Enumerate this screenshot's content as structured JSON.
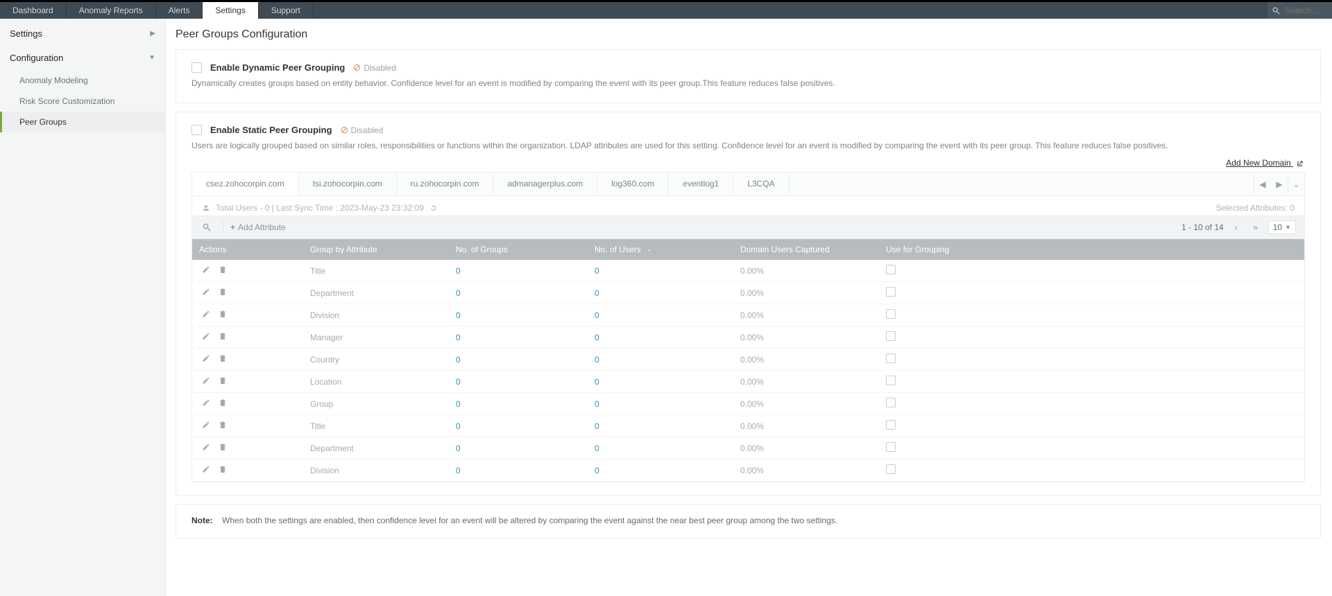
{
  "topnav": {
    "tabs": [
      "Dashboard",
      "Anomaly Reports",
      "Alerts",
      "Settings",
      "Support"
    ],
    "active_index": 3,
    "search_placeholder": "Search..."
  },
  "sidebar": {
    "sections": {
      "settings_label": "Settings",
      "configuration_label": "Configuration"
    },
    "config_items": [
      "Anomaly Modeling",
      "Risk Score Customization",
      "Peer Groups"
    ],
    "active_config_index": 2
  },
  "page": {
    "title": "Peer Groups Configuration"
  },
  "dynamic": {
    "title": "Enable Dynamic Peer Grouping",
    "status": "Disabled",
    "desc": "Dynamically creates groups based on entity behavior. Confidence level for an event is modified by comparing the event with its peer group.This feature reduces false positives."
  },
  "static": {
    "title": "Enable Static Peer Grouping",
    "status": "Disabled",
    "desc": "Users are logically grouped based on similar roles, responsibilities or functions within the organization. LDAP attributes are used for this setting. Confidence level for an event is modified by comparing the event with its peer group. This feature reduces false positives.",
    "add_new_domain": "Add New Domain"
  },
  "domains": {
    "tabs": [
      "csez.zohocorpin.com",
      "tsi.zohocorpin.com",
      "ru.zohocorpin.com",
      "admanagerplus.com",
      "log360.com",
      "eventlog1",
      "L3CQA"
    ],
    "active_index": 0
  },
  "summary": {
    "total_users_label": "Total Users - ",
    "total_users": "0",
    "sep": " | ",
    "last_sync_label": "Last Sync Time : ",
    "last_sync_time": "2023-May-23 23:32:09",
    "selected_attr_label": "Selected Attributes: ",
    "selected_attr_value": "0"
  },
  "toolbar": {
    "add_attribute": "Add Attribute",
    "pager_text": "1 - 10 of 14",
    "page_size": "10"
  },
  "table": {
    "headers": {
      "actions": "Actions",
      "group_by": "Group by Attribute",
      "no_groups": "No. of Groups",
      "no_users": "No. of Users",
      "captured": "Domain Users Captured",
      "use_for": "Use for Grouping"
    },
    "rows": [
      {
        "attr": "Title",
        "groups": "0",
        "users": "0",
        "captured": "0.00%"
      },
      {
        "attr": "Department",
        "groups": "0",
        "users": "0",
        "captured": "0.00%"
      },
      {
        "attr": "Division",
        "groups": "0",
        "users": "0",
        "captured": "0.00%"
      },
      {
        "attr": "Manager",
        "groups": "0",
        "users": "0",
        "captured": "0.00%"
      },
      {
        "attr": "Country",
        "groups": "0",
        "users": "0",
        "captured": "0.00%"
      },
      {
        "attr": "Location",
        "groups": "0",
        "users": "0",
        "captured": "0.00%"
      },
      {
        "attr": "Group",
        "groups": "0",
        "users": "0",
        "captured": "0.00%"
      },
      {
        "attr": "Title",
        "groups": "0",
        "users": "0",
        "captured": "0.00%"
      },
      {
        "attr": "Department",
        "groups": "0",
        "users": "0",
        "captured": "0.00%"
      },
      {
        "attr": "Division",
        "groups": "0",
        "users": "0",
        "captured": "0.00%"
      }
    ]
  },
  "note": {
    "label": "Note:",
    "text": "When both the settings are enabled, then confidence level for an event will be altered by comparing the event against the near best peer group among the two settings."
  }
}
